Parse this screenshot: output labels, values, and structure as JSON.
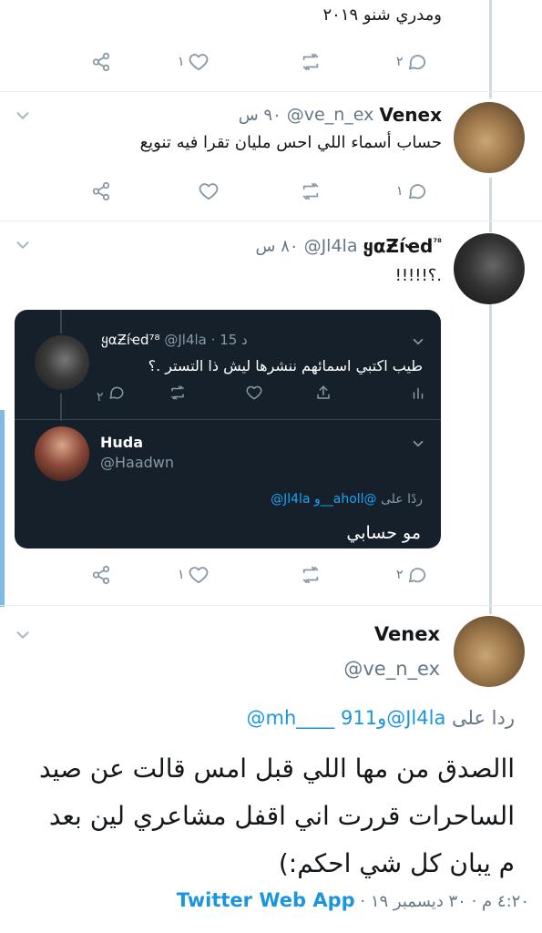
{
  "top_tweet": {
    "text": "ومدري شنو ٢٠١٩",
    "actions": {
      "reply_count": "٢",
      "retweet_count": "",
      "like_count": "١"
    }
  },
  "tweet1": {
    "name": "Venex",
    "handle": "@ve_n_ex",
    "time": "٩٠ س",
    "text": "حساب أسماء اللي احس مليان تقرا فيه تنويع",
    "actions": {
      "reply_count": "١",
      "retweet_count": "",
      "like_count": ""
    }
  },
  "tweet2": {
    "name": "ყαƵíҽd",
    "name_badge": "⁷⁸",
    "handle": "@Jl4la",
    "time": "٨٠ س",
    "text": "!!!!!؟.",
    "embed": {
      "quoted": {
        "name": "ყαƵíҽd⁷⁸",
        "handle": "@Jl4la",
        "time": "15 د",
        "text": "طيب اكتبي اسمائهم ننشرها ليش ذا التستر .؟",
        "reply_count": "٢"
      },
      "reply": {
        "name": "Huda",
        "handle": "@Haadwn",
        "replying_label": "ردًا على",
        "replying_to": "@Jl4la و__aholl@",
        "text": "مو حسابي"
      }
    },
    "actions": {
      "reply_count": "٢",
      "retweet_count": "",
      "like_count": "١"
    }
  },
  "main_tweet": {
    "name": "Venex",
    "handle": "@ve_n_ex",
    "replying_label": "ردا على",
    "replying_handle1": "@Jl4la",
    "replying_and": "و",
    "replying_handle2": "911",
    "replying_handle3": "@mh____",
    "text_line1": "االصدق من مها اللي قبل امس قالت عن صيد",
    "text_line2": "الساحرات قررت اني اقفل مشاعري لين بعد",
    "text_line3": "م يبان كل شي احكم:)",
    "time": "٤:٢٠ م",
    "dot": "·",
    "date": "٣٠ ديسمبر ١٩",
    "source": "Twitter Web App"
  },
  "icons": [
    "share-icon",
    "like-icon",
    "retweet-icon",
    "reply-icon",
    "chevron-down-icon",
    "stats-icon"
  ]
}
